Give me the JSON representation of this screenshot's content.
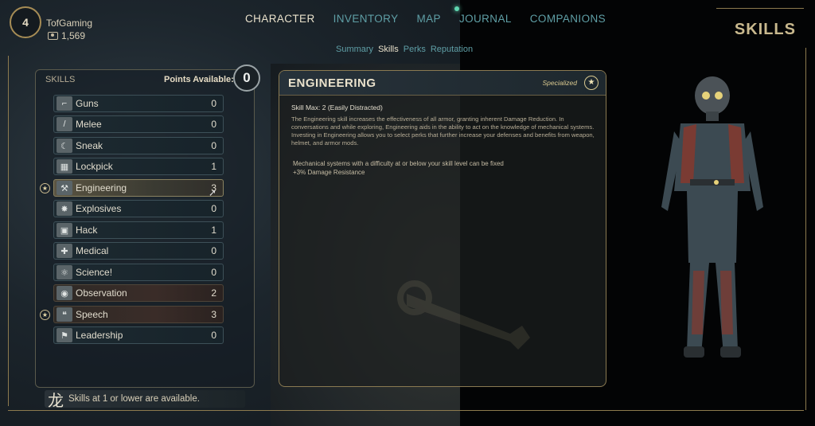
{
  "player": {
    "level": "4",
    "name": "TofGaming",
    "bits": "1,569"
  },
  "nav": {
    "tabs": [
      "CHARACTER",
      "INVENTORY",
      "MAP",
      "JOURNAL",
      "COMPANIONS"
    ],
    "active": "CHARACTER"
  },
  "subnav": {
    "tabs": [
      "Summary",
      "Skills",
      "Perks",
      "Reputation"
    ],
    "active": "Skills"
  },
  "page_heading": "SKILLS",
  "skills_panel": {
    "label": "SKILLS",
    "points_label": "Points Available:",
    "points_value": "0",
    "items": [
      {
        "name": "Guns",
        "value": "0",
        "icon": "gun-icon",
        "specialized": false
      },
      {
        "name": "Melee",
        "value": "0",
        "icon": "melee-icon",
        "specialized": false
      },
      {
        "name": "Sneak",
        "value": "0",
        "icon": "sneak-icon",
        "specialized": false
      },
      {
        "name": "Lockpick",
        "value": "1",
        "icon": "lockpick-icon",
        "specialized": false
      },
      {
        "name": "Engineering",
        "value": "3",
        "icon": "wrench-icon",
        "specialized": true,
        "selected": true
      },
      {
        "name": "Explosives",
        "value": "0",
        "icon": "explosives-icon",
        "specialized": false
      },
      {
        "name": "Hack",
        "value": "1",
        "icon": "hack-icon",
        "specialized": false
      },
      {
        "name": "Medical",
        "value": "0",
        "icon": "medical-icon",
        "specialized": false
      },
      {
        "name": "Science!",
        "value": "0",
        "icon": "science-icon",
        "specialized": false
      },
      {
        "name": "Observation",
        "value": "2",
        "icon": "observation-icon",
        "specialized": false
      },
      {
        "name": "Speech",
        "value": "3",
        "icon": "speech-icon",
        "specialized": true
      },
      {
        "name": "Leadership",
        "value": "0",
        "icon": "leadership-icon",
        "specialized": false
      }
    ],
    "footer_note": "Skills at 1 or lower are available."
  },
  "detail": {
    "title": "ENGINEERING",
    "specialized_label": "Specialized",
    "skill_max": "Skill Max: 2 (Easily Distracted)",
    "description": "The Engineering skill increases the effectiveness of all armor, granting inherent Damage Reduction. In conversations and while exploring, Engineering aids in the ability to act on the knowledge of mechanical systems. Investing in Engineering allows you to select perks that further increase your defenses and benefits from weapon, helmet, and armor mods.",
    "bonuses": [
      "Mechanical systems with a difficulty at or below your skill level can be fixed",
      "+3% Damage Resistance"
    ]
  },
  "colors": {
    "accent_gold": "#c9b98e",
    "nav_teal": "#5f9fa6",
    "panel_border": "#8a7a52"
  }
}
